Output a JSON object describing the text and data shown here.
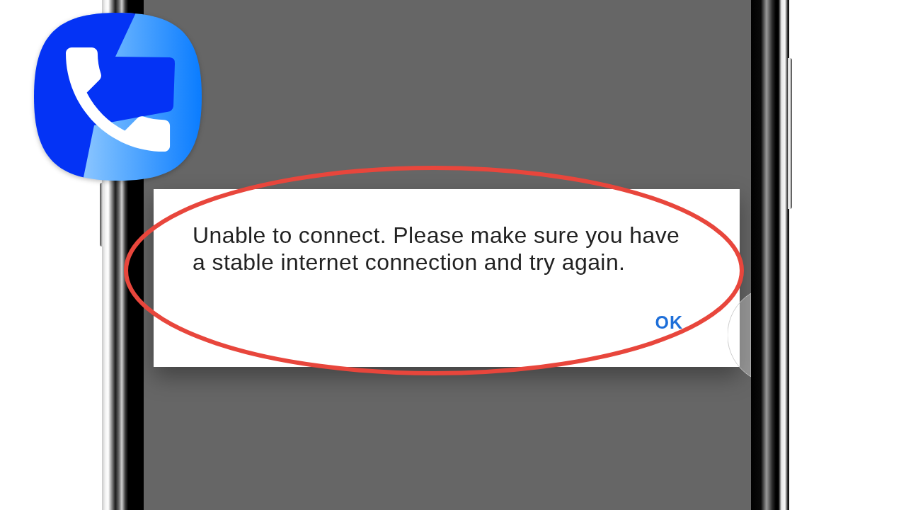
{
  "dialog": {
    "message": "Unable to connect. Please make sure you have a stable internet connection and try again.",
    "buttons": [
      "OK"
    ]
  }
}
